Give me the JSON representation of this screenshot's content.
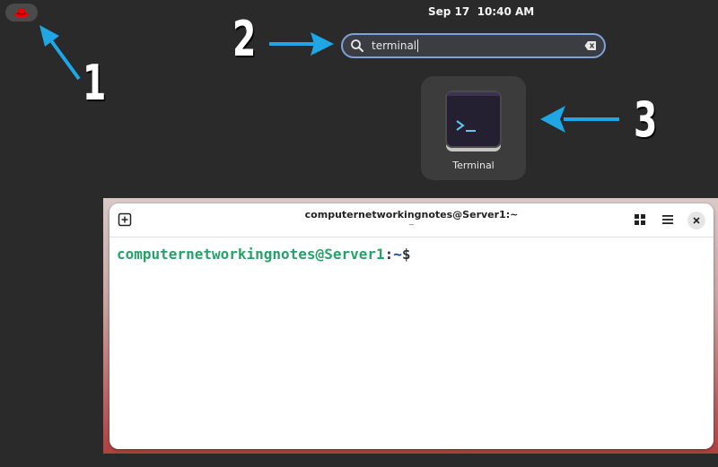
{
  "top_bar": {
    "clock": "Sep 17  10:40 AM",
    "activities_icon": "redhat-icon"
  },
  "search": {
    "value": "terminal",
    "search_icon": "search-icon",
    "clear_icon": "clear-icon"
  },
  "results": {
    "app": {
      "label": "Terminal",
      "icon": "terminal-app-icon"
    }
  },
  "annotations": {
    "n1": "1",
    "n2": "2",
    "n3": "3",
    "arrow_color": "#1ea7e4"
  },
  "terminal": {
    "title": "computernetworkingnotes@Server1:~",
    "subtitle": "~",
    "prompt_user": "computernetworkingnotes@Server1",
    "prompt_sep": ":",
    "prompt_path": "~",
    "prompt_symbol": "$"
  }
}
